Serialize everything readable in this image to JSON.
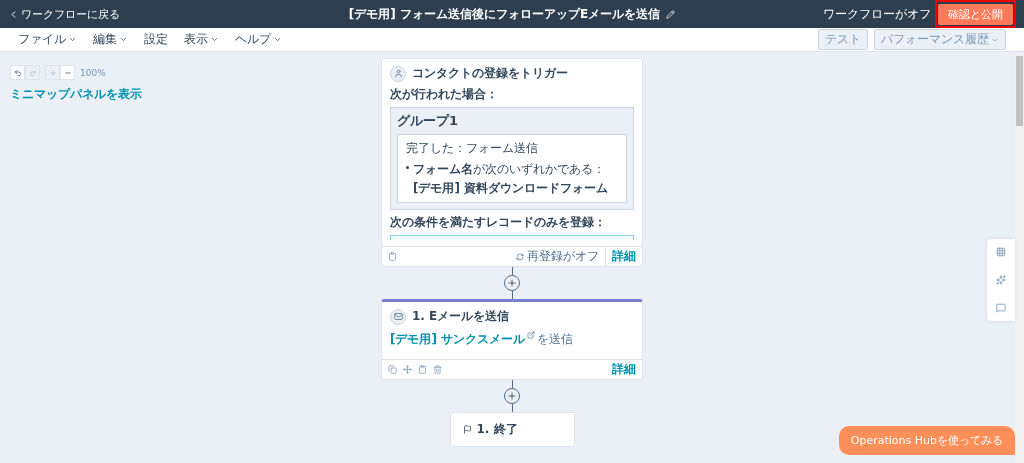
{
  "header": {
    "back_link": "ワークフローに戻る",
    "title": "[デモ用] フォーム送信後にフォローアップEメールを送信",
    "status": "ワークフローがオフ",
    "publish_button": "確認と公開",
    "highlighted": true
  },
  "menu": [
    {
      "label": "ファイル",
      "dropdown": true
    },
    {
      "label": "編集",
      "dropdown": true
    },
    {
      "label": "設定",
      "dropdown": false
    },
    {
      "label": "表示",
      "dropdown": true
    },
    {
      "label": "ヘルプ",
      "dropdown": true
    }
  ],
  "toolbar_buttons": [
    {
      "label": "テスト",
      "dropdown": false
    },
    {
      "label": "パフォーマンス履歴",
      "dropdown": true
    }
  ],
  "zoom": {
    "level_text": "100%",
    "minimap_link": "ミニマップパネルを表示"
  },
  "trigger": {
    "title": "コンタクトの登録をトリガー",
    "when_label": "次が行われた場合：",
    "group_title": "グループ1",
    "condition_title": "完了した：フォーム送信",
    "condition_detail": "**フォーム名**が次のいずれかである：",
    "condition_value": "[デモ用] 資料ダウンロードフォーム",
    "filter_label": "次の条件を満たすレコードのみを登録：",
    "reenroll": "再登録がオフ",
    "details": "詳細"
  },
  "action": {
    "title": "1. Eメールを送信",
    "email_link": "[デモ用] サンクスメール",
    "suffix": "を送信",
    "details": "詳細"
  },
  "end": {
    "title": "1. 終了"
  },
  "promo_button": "Operations Hubを使ってみる"
}
